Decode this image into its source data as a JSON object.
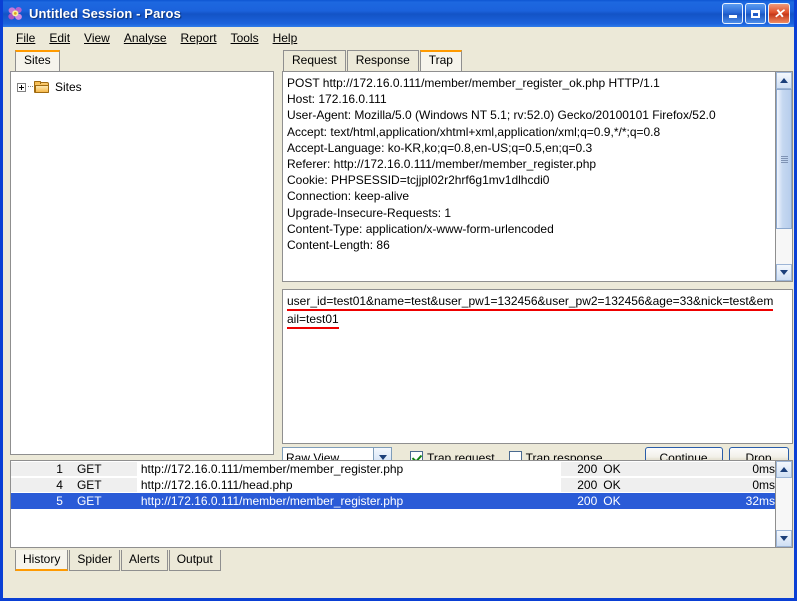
{
  "window": {
    "title": "Untitled Session - Paros",
    "app_icon": "flower-icon",
    "minimize_label": "_",
    "maximize_label": "□",
    "close_label": "✕"
  },
  "menubar": {
    "items": [
      {
        "label": "File"
      },
      {
        "label": "Edit"
      },
      {
        "label": "View"
      },
      {
        "label": "Analyse"
      },
      {
        "label": "Report"
      },
      {
        "label": "Tools"
      },
      {
        "label": "Help"
      }
    ]
  },
  "sites_panel": {
    "tab_label": "Sites",
    "tree": {
      "root_label": "Sites",
      "expander": "plus-icon",
      "folder": "folder-icon"
    }
  },
  "request_panel": {
    "tabs": [
      {
        "label": "Request",
        "selected": false
      },
      {
        "label": "Response",
        "selected": false
      },
      {
        "label": "Trap",
        "selected": true
      }
    ],
    "headers": [
      "POST http://172.16.0.111/member/member_register_ok.php HTTP/1.1",
      "Host: 172.16.0.111",
      "User-Agent: Mozilla/5.0 (Windows NT 5.1; rv:52.0) Gecko/20100101 Firefox/52.0",
      "Accept: text/html,application/xhtml+xml,application/xml;q=0.9,*/*;q=0.8",
      "Accept-Language: ko-KR,ko;q=0.8,en-US;q=0.5,en;q=0.3",
      "Referer: http://172.16.0.111/member/member_register.php",
      "Cookie: PHPSESSID=tcjjpl02r2hrf6g1mv1dlhcdi0",
      "Connection: keep-alive",
      "Upgrade-Insecure-Requests: 1",
      "Content-Type: application/x-www-form-urlencoded",
      "Content-Length: 86"
    ],
    "body_lines": [
      "user_id=test01&name=test&user_pw1=132456&user_pw2=132456&age=33&nick=test&em",
      "ail=test01"
    ],
    "body_highlight_color": "#ee0000",
    "controls": {
      "view_mode": "Raw View",
      "trap_request": {
        "label": "Trap request",
        "checked": true
      },
      "trap_response": {
        "label": "Trap response",
        "checked": false
      },
      "continue_label": "Continue",
      "drop_label": "Drop"
    }
  },
  "history": {
    "rows": [
      {
        "id": "1",
        "method": "GET",
        "url": "http://172.16.0.111/member/member_register.php",
        "code": "200",
        "status": "OK",
        "time": "0ms",
        "selected": false
      },
      {
        "id": "4",
        "method": "GET",
        "url": "http://172.16.0.111/head.php",
        "code": "200",
        "status": "OK",
        "time": "0ms",
        "selected": false
      },
      {
        "id": "5",
        "method": "GET",
        "url": "http://172.16.0.111/member/member_register.php",
        "code": "200",
        "status": "OK",
        "time": "32ms",
        "selected": true
      }
    ],
    "selection_color": "#2a5bd7"
  },
  "bottom_tabs": [
    {
      "label": "History",
      "selected": true
    },
    {
      "label": "Spider",
      "selected": false
    },
    {
      "label": "Alerts",
      "selected": false
    },
    {
      "label": "Output",
      "selected": false
    }
  ],
  "theme": {
    "titlebar_blue": "#1b62dc",
    "face": "#ece9d8",
    "accent_orange": "#ff9a00",
    "border_blue": "#0a3fd4"
  }
}
